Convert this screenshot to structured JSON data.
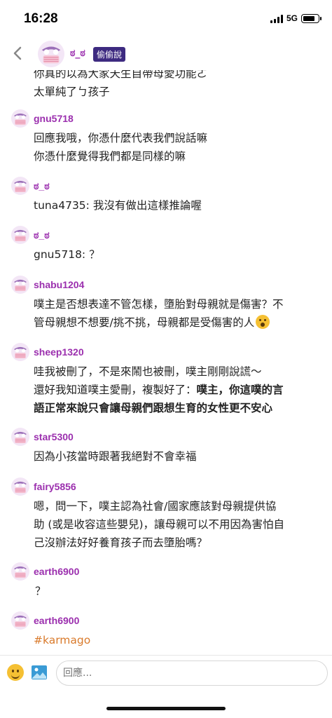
{
  "status_bar": {
    "time": "16:28",
    "network": "5G",
    "battery_level": 0.85
  },
  "header": {
    "name": "ಠ_ಠ",
    "badge": "偷偷說"
  },
  "top_partial_text": [
    "你真的以為大家天生自帶母愛功能ㄛ",
    "太單純了ㄅ孩子"
  ],
  "messages": [
    {
      "author": "gnu5718",
      "lines": [
        "回應我哦，你憑什麼代表我們說話嘛",
        "你憑什麼覺得我們都是同樣的嘛"
      ]
    },
    {
      "author": "ಠ_ಠ",
      "lines": [
        "tuna4735: 我沒有做出這樣推論喔"
      ]
    },
    {
      "author": "ಠ_ಠ",
      "lines": [
        "gnu5718: ？"
      ]
    },
    {
      "author": "shabu1204",
      "lines": [
        "噗主是否想表達不管怎樣，墮胎對母親就是傷害？不",
        "管母親想不想要/挑不挑，母親都是受傷害的人"
      ]
    },
    {
      "author": "sheep1320",
      "lines": [
        "哇我被刪了，不是來鬧也被刪，噗主剛剛說謊～",
        "還好我知道噗主愛刪，複製好了："
      ],
      "bold_inline": "噗主，你這噗的言",
      "bold_line": "語正常來說只會讓母親們跟想生育的女性更不安心"
    },
    {
      "author": "star5300",
      "lines": [
        "因為小孩當時跟著我絕對不會幸福"
      ]
    },
    {
      "author": "fairy5856",
      "lines": [
        "嗯，問一下，噗主認為社會/國家應該對母親提供協",
        "助 (或是收容這些嬰兒)，讓母親可以不用因為害怕自",
        "己沒辦法好好養育孩子而去墮胎嗎？"
      ]
    },
    {
      "author": "earth6900",
      "lines": [
        "？"
      ]
    },
    {
      "author": "earth6900",
      "tag": "#karmago"
    }
  ],
  "composer": {
    "placeholder": "回應..."
  },
  "colors": {
    "author": "#9b2fae",
    "badge_bg": "#3d2a80",
    "tag": "#d97a2b"
  },
  "icons": [
    "back-chevron-icon",
    "emoji-icon",
    "image-icon",
    "signal-icon",
    "battery-icon"
  ]
}
